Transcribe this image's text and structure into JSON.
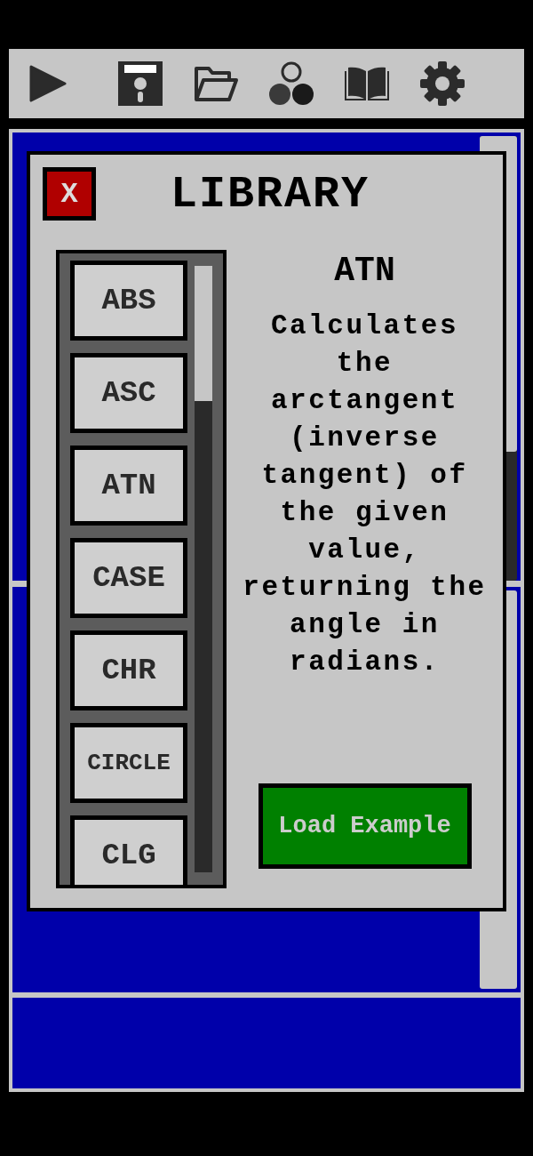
{
  "toolbar": {
    "buttons": [
      {
        "kind": "run"
      },
      {
        "kind": "save"
      },
      {
        "kind": "open"
      },
      {
        "kind": "sprites"
      },
      {
        "kind": "library"
      },
      {
        "kind": "settings"
      }
    ]
  },
  "library": {
    "title": "LIBRARY",
    "close": "X",
    "items": [
      "ABS",
      "ASC",
      "ATN",
      "CASE",
      "CHR",
      "CIRCLE",
      "CLG"
    ],
    "entry": {
      "name": "ATN",
      "description": "Calculates the arctangent (inverse tangent) of the given value, returning the angle in radians."
    },
    "load_button": "Load Example"
  }
}
